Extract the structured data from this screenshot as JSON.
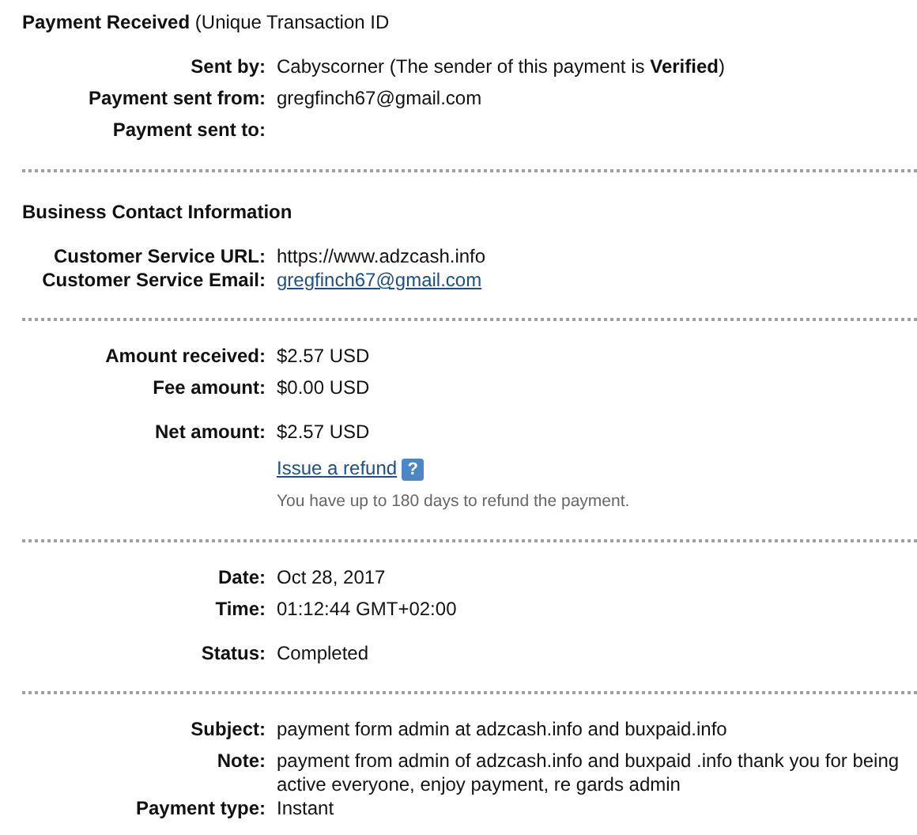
{
  "header": {
    "title": "Payment Received",
    "subtitle": "(Unique Transaction ID"
  },
  "sections": [
    {
      "rows": [
        {
          "kind": "field",
          "label": "Sent by:",
          "value": "Cabyscorner (The sender of this payment is **Verified**)"
        },
        {
          "kind": "field",
          "label": "Payment sent from:",
          "value": "gregfinch67@gmail.com"
        },
        {
          "kind": "field",
          "label": "Payment sent to:"
        }
      ]
    },
    {
      "heading": "Business Contact Information",
      "rows": [
        {
          "kind": "field",
          "label": "Customer Service URL:",
          "value": "https://www.adzcash.info"
        },
        {
          "kind": "link",
          "label": "Customer Service Email:",
          "value": "gregfinch67@gmail.com"
        }
      ]
    },
    {
      "rows": [
        {
          "kind": "field",
          "label": "Amount received:",
          "value": "$2.57 USD"
        },
        {
          "kind": "field",
          "label": "Fee amount:",
          "value": "$0.00 USD"
        },
        {
          "kind": "field",
          "label": "Net amount:",
          "value": "$2.57 USD"
        },
        {
          "kind": "refund",
          "link": "Issue a refund",
          "help": "?",
          "note": "You have up to 180 days to refund the payment."
        }
      ]
    },
    {
      "rows": [
        {
          "kind": "field",
          "label": "Date:",
          "value": "Oct 28, 2017"
        },
        {
          "kind": "field",
          "label": "Time:",
          "value": "01:12:44 GMT+02:00"
        },
        {
          "kind": "field",
          "label": "Status:",
          "value": "Completed"
        }
      ]
    },
    {
      "rows": [
        {
          "kind": "field",
          "label": "Subject:",
          "value": "payment form admin at adzcash.info and buxpaid.info"
        },
        {
          "kind": "field",
          "label": "Note:",
          "value": "payment from admin of adzcash.info and buxpaid .info thank you for being active everyone, enjoy payment, re gards admin"
        },
        {
          "kind": "field",
          "label": "Payment type:",
          "value": "Instant"
        }
      ]
    }
  ]
}
